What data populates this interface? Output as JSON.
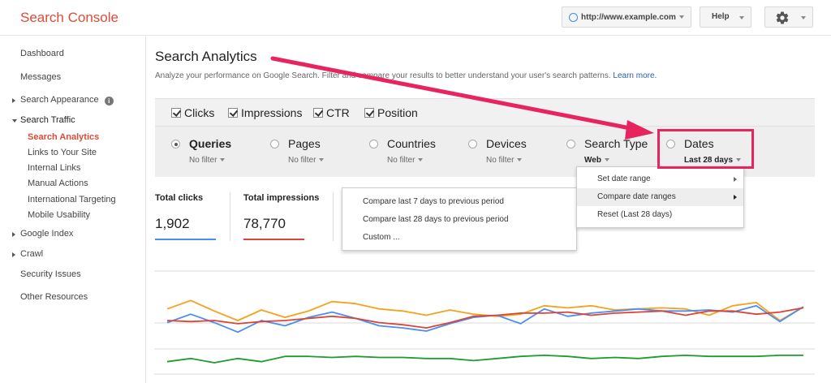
{
  "header": {
    "brand": "Search Console",
    "site": "http://www.example.com",
    "help_label": "Help",
    "icons": [
      "globe-icon",
      "gear-icon",
      "chevron-down-icon"
    ]
  },
  "sidebar": {
    "items": [
      {
        "label": "Dashboard"
      },
      {
        "label": "Messages"
      },
      {
        "label": "Search Appearance"
      },
      {
        "label": "Search Traffic"
      },
      {
        "label": "Google Index"
      },
      {
        "label": "Crawl"
      },
      {
        "label": "Security Issues"
      },
      {
        "label": "Other Resources"
      }
    ],
    "traffic_sub": [
      {
        "label": "Search Analytics"
      },
      {
        "label": "Links to Your Site"
      },
      {
        "label": "Internal Links"
      },
      {
        "label": "Manual Actions"
      },
      {
        "label": "International Targeting"
      },
      {
        "label": "Mobile Usability"
      }
    ],
    "info_glyph": "i"
  },
  "main": {
    "title": "Search Analytics",
    "description": "Analyze your performance on Google Search. Filter and compare your results to better understand your user's search patterns.",
    "learn_more": "Learn more."
  },
  "metrics": {
    "clicks": "Clicks",
    "impressions": "Impressions",
    "ctr": "CTR",
    "position": "Position"
  },
  "dimensions": {
    "queries": {
      "label": "Queries",
      "filter": "No filter"
    },
    "pages": {
      "label": "Pages",
      "filter": "No filter"
    },
    "countries": {
      "label": "Countries",
      "filter": "No filter"
    },
    "devices": {
      "label": "Devices",
      "filter": "No filter"
    },
    "search_type": {
      "label": "Search Type",
      "filter": "Web"
    },
    "dates": {
      "label": "Dates",
      "filter": "Last 28 days"
    }
  },
  "stats": {
    "clicks_label": "Total clicks",
    "clicks_value": "1,902",
    "impressions_label": "Total impressions",
    "impressions_value": "78,770"
  },
  "date_menu": {
    "items": [
      "Set date range",
      "Compare date ranges",
      "Reset (Last 28 days)"
    ]
  },
  "compare_menu": {
    "items": [
      "Compare last 7 days to previous period",
      "Compare last 28 days to previous period",
      "Custom ..."
    ]
  },
  "colors": {
    "brand": "#dd4b39",
    "annotation": "#e8245f",
    "clicks": "#4a8ef0",
    "impressions": "#db4437",
    "ctr": "#f4a21e",
    "position": "#1e9c2e"
  },
  "chart_data": {
    "type": "line",
    "x": [
      1,
      2,
      3,
      4,
      5,
      6,
      7,
      8,
      9,
      10,
      11,
      12,
      13,
      14,
      15,
      16,
      17,
      18,
      19,
      20,
      21,
      22,
      23,
      24,
      25,
      26,
      27,
      28
    ],
    "series": [
      {
        "name": "CTR",
        "values": [
          61,
          69,
          59,
          50,
          60,
          53,
          59,
          68,
          66,
          61,
          59,
          55,
          60,
          56,
          54,
          56,
          64,
          62,
          64,
          60,
          61,
          62,
          61,
          55,
          64,
          67,
          50,
          63
        ]
      },
      {
        "name": "Clicks",
        "values": [
          48,
          56,
          48,
          39,
          50,
          45,
          53,
          58,
          52,
          45,
          43,
          40,
          47,
          53,
          55,
          47,
          61,
          54,
          57,
          59,
          61,
          59,
          59,
          60,
          58,
          64,
          49,
          63
        ]
      },
      {
        "name": "Impressions",
        "values": [
          50,
          49,
          50,
          47,
          49,
          50,
          52,
          54,
          52,
          48,
          46,
          43,
          48,
          54,
          55,
          57,
          57,
          58,
          55,
          57,
          58,
          59,
          55,
          59,
          59,
          56,
          58,
          62
        ]
      },
      {
        "name": "Position",
        "values": [
          11,
          14,
          10,
          14,
          11,
          16,
          16,
          15,
          16,
          15,
          15,
          14,
          14,
          12,
          14,
          16,
          17,
          16,
          14,
          15,
          14,
          16,
          17,
          16,
          16,
          16,
          17,
          17
        ]
      }
    ]
  }
}
